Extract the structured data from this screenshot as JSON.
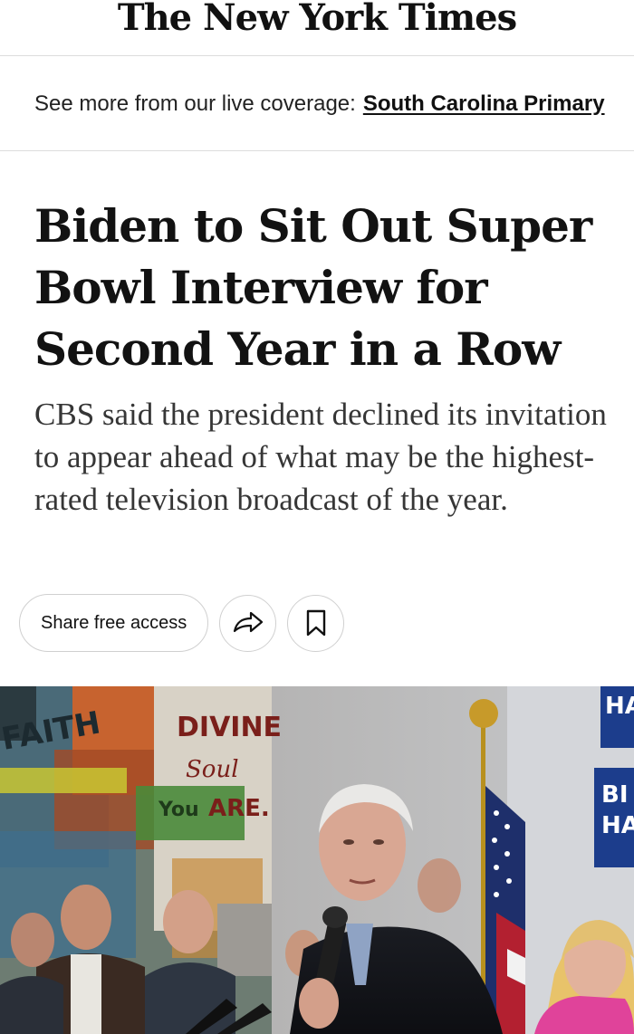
{
  "masthead": {
    "logo_text": "The New York Times"
  },
  "live_coverage": {
    "prefix": "See more from our live coverage:",
    "link_label": "South Carolina Primary"
  },
  "article": {
    "headline": "Biden to Sit Out Super Bowl Interview for Second Year in a Row",
    "summary": "CBS said the president declined its invitation to appear ahead of what may be the highest-rated television broadcast of the year."
  },
  "actions": {
    "share_free_access_label": "Share free access",
    "share_icon": "share-arrow-icon",
    "save_icon": "bookmark-icon"
  },
  "photo": {
    "mural_text": [
      "FAITH",
      "DIVINE",
      "Soul",
      "You",
      "ARE."
    ],
    "sign_text": [
      "HA",
      "BI",
      "HA"
    ]
  }
}
